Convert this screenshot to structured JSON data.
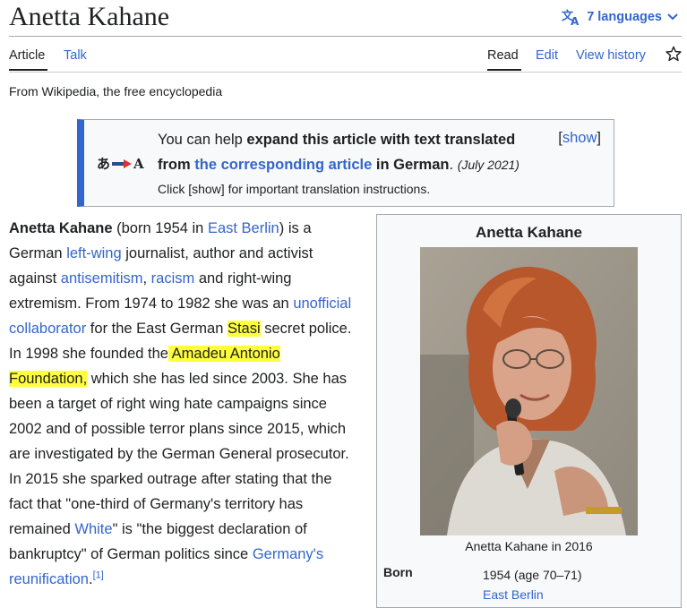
{
  "page": {
    "title": "Anetta Kahane",
    "languages_label": "7 languages",
    "tagline": "From Wikipedia, the free encyclopedia"
  },
  "tabs": {
    "left": [
      "Article",
      "Talk"
    ],
    "right": [
      "Read",
      "Edit",
      "View history"
    ]
  },
  "ambox": {
    "icon_left": "あ",
    "icon_right": "A",
    "line1_plain": "You can help ",
    "line1_bold": "expand this article with text translated",
    "line2_bold_start": "from ",
    "line2_link": "the corresponding article",
    "line2_bold_end": " in German",
    "line2_period": ".",
    "date": "(July 2021)",
    "small": "Click [show] for important translation instructions.",
    "show_open": "[",
    "show_label": "show",
    "show_close": "]"
  },
  "article": {
    "s1": "Anetta Kahane",
    "s2": " (born 1954 in ",
    "l_east_berlin": "East Berlin",
    "s3": ") is a German ",
    "l_left_wing": "left-wing",
    "s4": " journalist, author and activist against ",
    "l_antisemitism": "antisemitism",
    "s5": ", ",
    "l_racism": "racism",
    "s6": " and right-wing extremism. From 1974 to 1982 she was an ",
    "l_unofficial": "unofficial collaborator",
    "s7": " for the East German ",
    "h_stasi": "Stasi",
    "s8": " secret police. In 1998 she founded the",
    "h_amadeu": " Amadeu Antonio Foundation,",
    "s9": " which she has led since 2003. She has been a target of right wing hate campaigns since 2002 and of possible terror plans since 2015, which are investigated by the German General prosecutor. In 2015 she sparked outrage after stating that the fact that \"one-third of Germany's territory has remained ",
    "l_white": "White",
    "s10": "\" is \"the biggest declaration of bankruptcy\" of German politics since ",
    "l_reunification": "Germany's reunification",
    "s11": ".",
    "ref": "[1]"
  },
  "infobox": {
    "title": "Anetta Kahane",
    "caption": "Anetta Kahane in 2016",
    "born_label": "Born",
    "born_value": "1954 (age 70–71)",
    "born_place": "East Berlin"
  },
  "icons": {
    "language": "translate-icon",
    "chevron": "chevron-down-icon",
    "watch": "star-icon",
    "translation": "translation-arrow-icon"
  },
  "colors": {
    "link": "#3366cc",
    "highlight": "#ffff3c",
    "ambox_border": "#3366cc",
    "arrow": "#dd3333"
  }
}
